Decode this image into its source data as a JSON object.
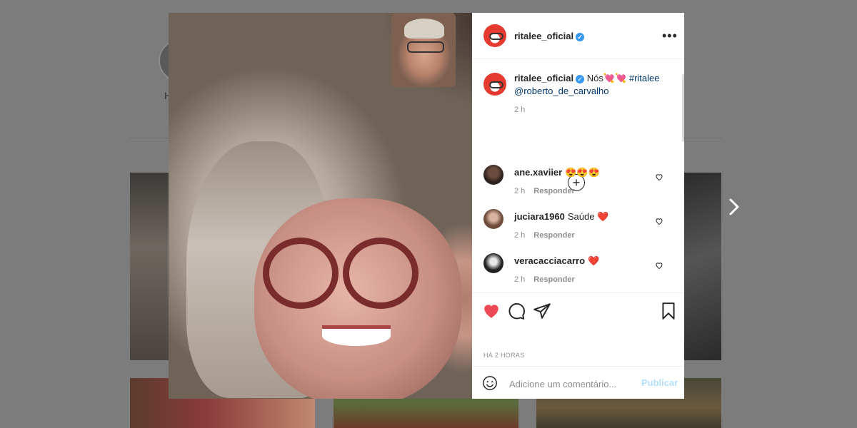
{
  "background": {
    "profile_letter": "H"
  },
  "post": {
    "username": "ritalee_oficial",
    "more_icon": "•••",
    "caption": {
      "username": "ritalee_oficial",
      "text": "Nós",
      "emojis": "💘💘",
      "hashtag": "#ritalee",
      "mention": "@roberto_de_carvalho"
    },
    "caption_time": "2 h",
    "comments": [
      {
        "username": "ane.xaviier",
        "text": "😍😍😍",
        "time": "2 h",
        "reply": "Responder"
      },
      {
        "username": "juciara1960",
        "text": "Saúde ❤️",
        "time": "2 h",
        "reply": "Responder"
      },
      {
        "username": "veracacciacarro",
        "text": "❤️",
        "time": "2 h",
        "reply": "Responder"
      }
    ],
    "timestamp": "HÁ 2 HORAS",
    "comment_placeholder": "Adicione um comentário...",
    "publish_label": "Publicar",
    "liked": true
  },
  "colors": {
    "like": "#ed4956",
    "link": "#00376b",
    "verified": "#3897f0",
    "publish_disabled": "#b2dffc"
  }
}
